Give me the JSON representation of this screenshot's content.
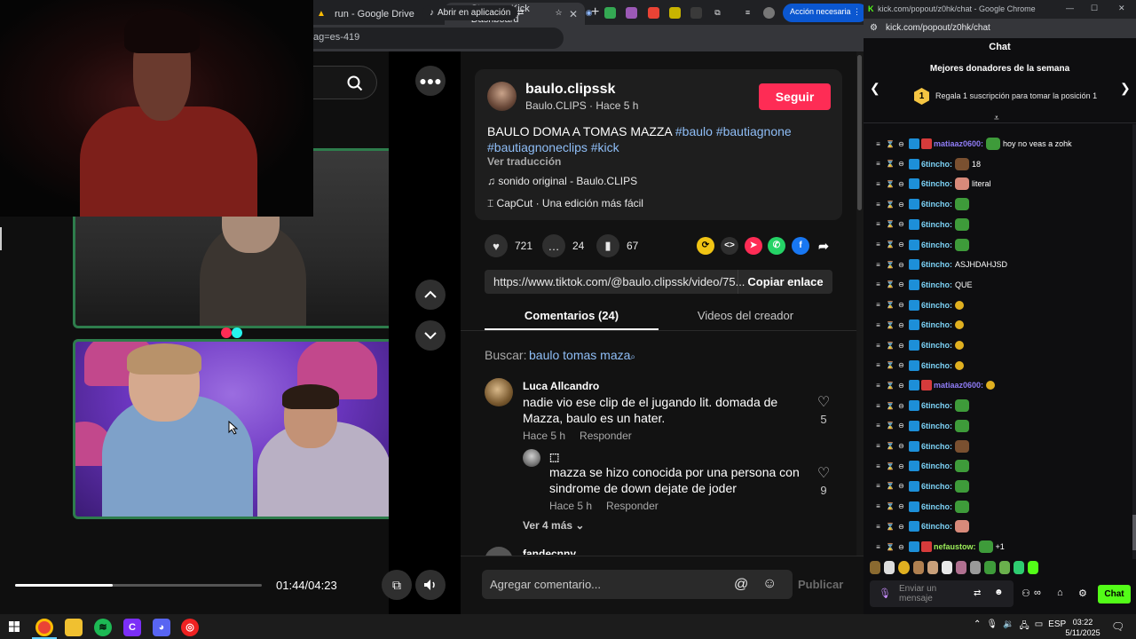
{
  "browser": {
    "tabs": [
      {
        "title": "run - Google Drive"
      },
      {
        "title": "Stream - Kick Dashboard"
      }
    ],
    "address_fragment": "ag=es-419",
    "open_in_app": "Abrir en aplicación",
    "action_needed": "Acción necesaria"
  },
  "video": {
    "current_time": "01:44/04:23",
    "progress_fraction": 0.397
  },
  "post": {
    "username": "baulo.clipssk",
    "subtitle": "Baulo.CLIPS · Hace 5 h",
    "follow_label": "Seguir",
    "caption_text": "BAULO DOMA A TOMAS MAZZA ",
    "caption_tags": [
      "#baulo",
      "#bautiagnone",
      "#bautiagnoneclips",
      "#kick"
    ],
    "translate": "Ver traducción",
    "music": "sonido original - Baulo.CLIPS",
    "capcut": "CapCut · Una edición más fácil",
    "likes": "721",
    "comments": "24",
    "saves": "67",
    "url": "https://www.tiktok.com/@baulo.clipssk/video/75...",
    "copy_label": "Copiar enlace"
  },
  "tabs": {
    "comments": "Comentarios (24)",
    "creator_videos": "Videos del creador"
  },
  "search": {
    "label": "Buscar:",
    "term": "baulo tomas maza"
  },
  "comments": [
    {
      "name": "Luca Allcandro",
      "line1": "nadie vio ese clip de el jugando lit. domada de",
      "line2": "Mazza, baulo es un hater.",
      "time": "Hace 5 h",
      "reply": "Responder",
      "likes": "5"
    }
  ],
  "reply": {
    "name": "⬚",
    "line1": "mazza se hizo conocida por una persona con",
    "line2": "sindrome de down dejate de joder",
    "time": "Hace 5 h",
    "reply": "Responder",
    "likes": "9"
  },
  "more_replies": "Ver 4 más",
  "next_comment_name": "fandecnny",
  "comment_input": {
    "placeholder": "Agregar comentario...",
    "publish": "Publicar"
  },
  "kick": {
    "window_title": "kick.com/popout/z0hk/chat - Google Chrome",
    "url": "kick.com/popout/z0hk/chat",
    "header": "Chat",
    "donors_title": "Mejores donadores de la semana",
    "donors_sub": "Regala 1 suscripción para tomar la posición 1",
    "donor_position": "1",
    "messages": [
      {
        "user": "matiaaz0600:",
        "text": "hoy no veas a zohk",
        "style": "alt"
      },
      {
        "user": "6tincho:",
        "text": "18",
        "style": "normal"
      },
      {
        "user": "6tincho:",
        "text": "literal",
        "style": "normal"
      },
      {
        "user": "6tincho:",
        "text": "",
        "style": "normal"
      },
      {
        "user": "6tincho:",
        "text": "",
        "style": "normal"
      },
      {
        "user": "6tincho:",
        "text": "",
        "style": "normal"
      },
      {
        "user": "6tincho:",
        "text": "ASJHDAHJSD",
        "style": "normal"
      },
      {
        "user": "6tincho:",
        "text": "QUE",
        "style": "normal"
      },
      {
        "user": "6tincho:",
        "text": "",
        "style": "normal"
      },
      {
        "user": "6tincho:",
        "text": "",
        "style": "normal"
      },
      {
        "user": "6tincho:",
        "text": "",
        "style": "normal"
      },
      {
        "user": "6tincho:",
        "text": "",
        "style": "normal"
      },
      {
        "user": "matiaaz0600:",
        "text": "",
        "style": "alt"
      },
      {
        "user": "6tincho:",
        "text": "",
        "style": "normal"
      },
      {
        "user": "6tincho:",
        "text": "",
        "style": "normal"
      },
      {
        "user": "6tincho:",
        "text": "",
        "style": "normal"
      },
      {
        "user": "6tincho:",
        "text": "",
        "style": "normal"
      },
      {
        "user": "6tincho:",
        "text": "",
        "style": "normal"
      },
      {
        "user": "6tincho:",
        "text": "",
        "style": "normal"
      },
      {
        "user": "6tincho:",
        "text": "",
        "style": "normal"
      },
      {
        "user": "nefaustow:",
        "text": "+1",
        "style": "green"
      }
    ],
    "input_placeholder": "Enviar un mensaje",
    "chat_button": "Chat"
  },
  "taskbar": {
    "lang": "ESP",
    "time": "03:22",
    "date": "5/11/2025"
  }
}
